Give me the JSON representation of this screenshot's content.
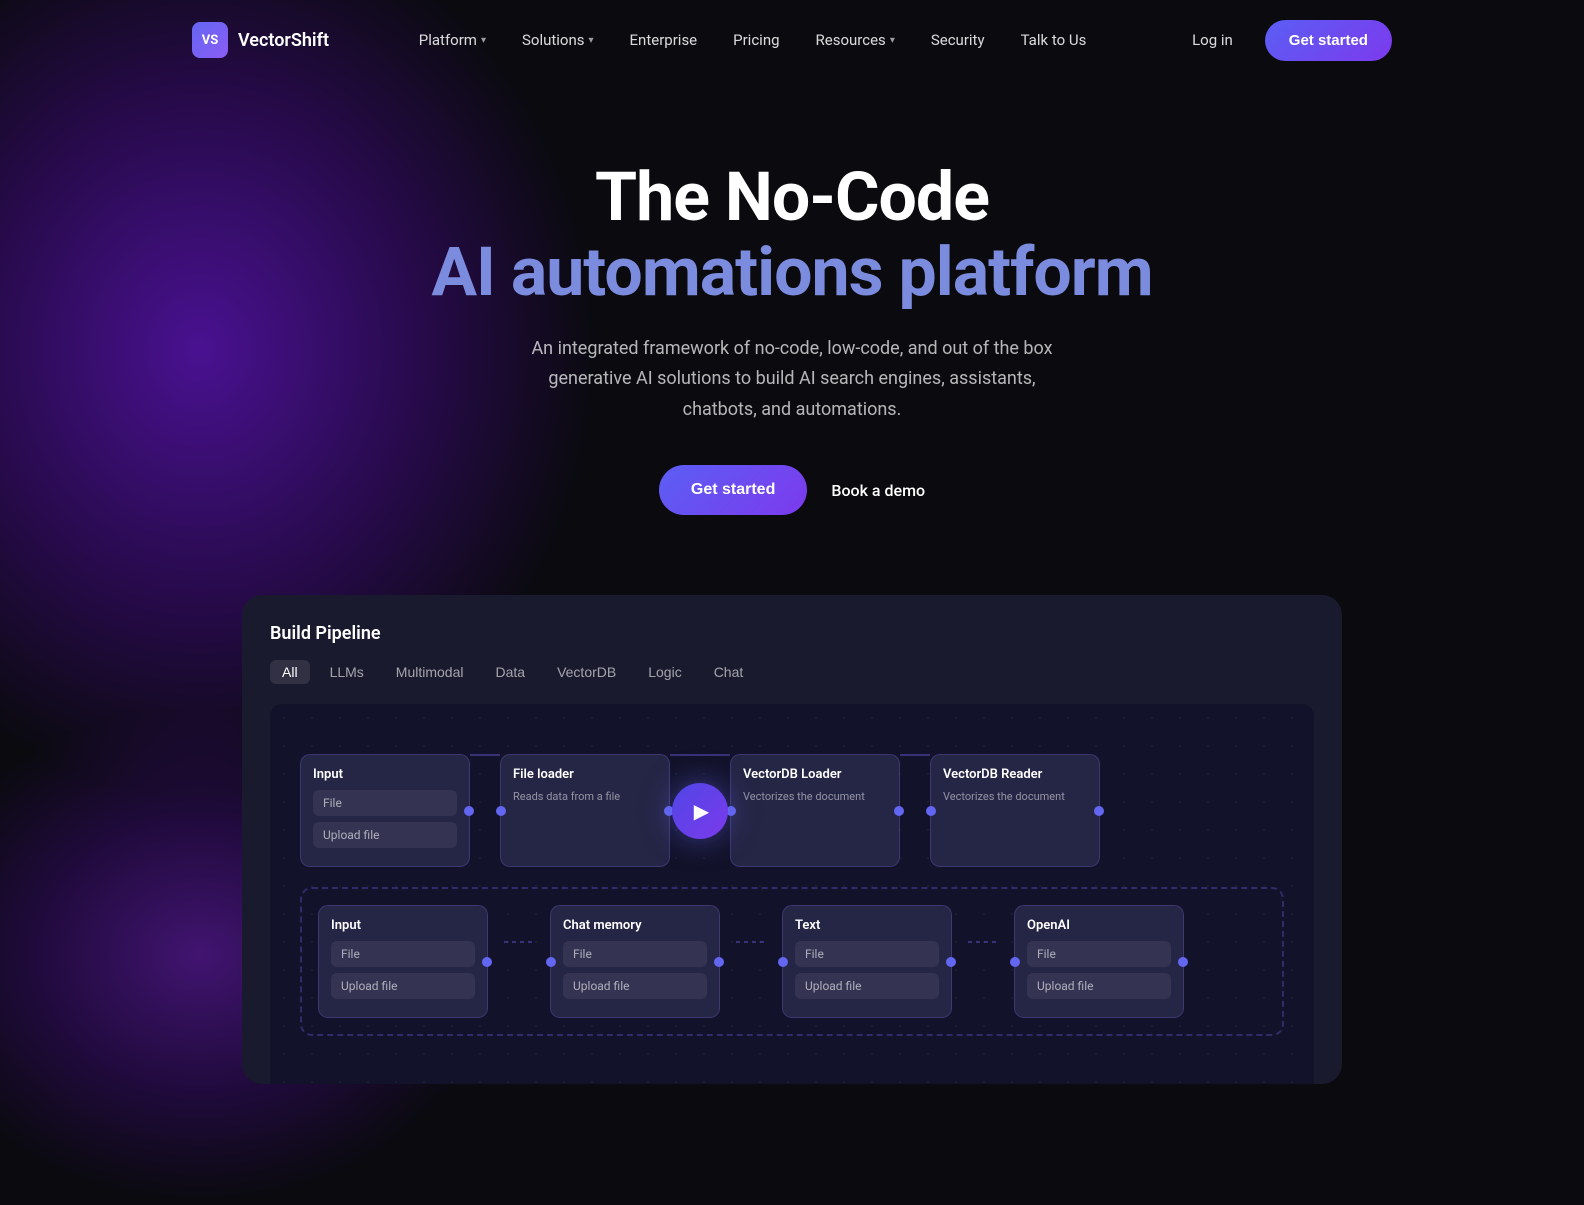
{
  "nav": {
    "logo_text": "VectorShift",
    "logo_initials": "VS",
    "links": [
      {
        "label": "Platform",
        "has_chevron": true,
        "id": "platform"
      },
      {
        "label": "Solutions",
        "has_chevron": true,
        "id": "solutions"
      },
      {
        "label": "Enterprise",
        "has_chevron": false,
        "id": "enterprise"
      },
      {
        "label": "Pricing",
        "has_chevron": false,
        "id": "pricing"
      },
      {
        "label": "Resources",
        "has_chevron": true,
        "id": "resources"
      },
      {
        "label": "Security",
        "has_chevron": false,
        "id": "security"
      },
      {
        "label": "Talk to Us",
        "has_chevron": false,
        "id": "talk-to-us"
      }
    ],
    "login_label": "Log in",
    "get_started_label": "Get started"
  },
  "hero": {
    "title_line1": "The No-Code",
    "title_line2": "AI automations platform",
    "subtitle": "An integrated framework of no-code, low-code, and out of the box generative AI solutions to build AI search engines, assistants, chatbots, and automations.",
    "cta_primary": "Get started",
    "cta_secondary": "Book a demo"
  },
  "pipeline": {
    "title": "Build Pipeline",
    "tabs": [
      {
        "label": "All",
        "active": true
      },
      {
        "label": "LLMs",
        "active": false
      },
      {
        "label": "Multimodal",
        "active": false
      },
      {
        "label": "Data",
        "active": false
      },
      {
        "label": "VectorDB",
        "active": false
      },
      {
        "label": "Logic",
        "active": false
      },
      {
        "label": "Chat",
        "active": false
      }
    ],
    "row1_nodes": [
      {
        "title": "Input",
        "fields": [
          "File",
          "Upload file"
        ],
        "desc": null
      },
      {
        "title": "File loader",
        "fields": [],
        "desc": "Reads data from a file"
      },
      {
        "title": "VectorDB Loader",
        "fields": [],
        "desc": "Vectorizes the document"
      },
      {
        "title": "VectorDB Reader",
        "fields": [],
        "desc": "Vectorizes the document"
      }
    ],
    "row2_nodes": [
      {
        "title": "Input",
        "fields": [
          "File",
          "Upload file"
        ],
        "desc": null
      },
      {
        "title": "Chat memory",
        "fields": [
          "File",
          "Upload file"
        ],
        "desc": null
      },
      {
        "title": "Text",
        "fields": [
          "File",
          "Upload file"
        ],
        "desc": null
      },
      {
        "title": "OpenAI",
        "fields": [
          "File",
          "Upload file"
        ],
        "desc": null
      }
    ]
  }
}
